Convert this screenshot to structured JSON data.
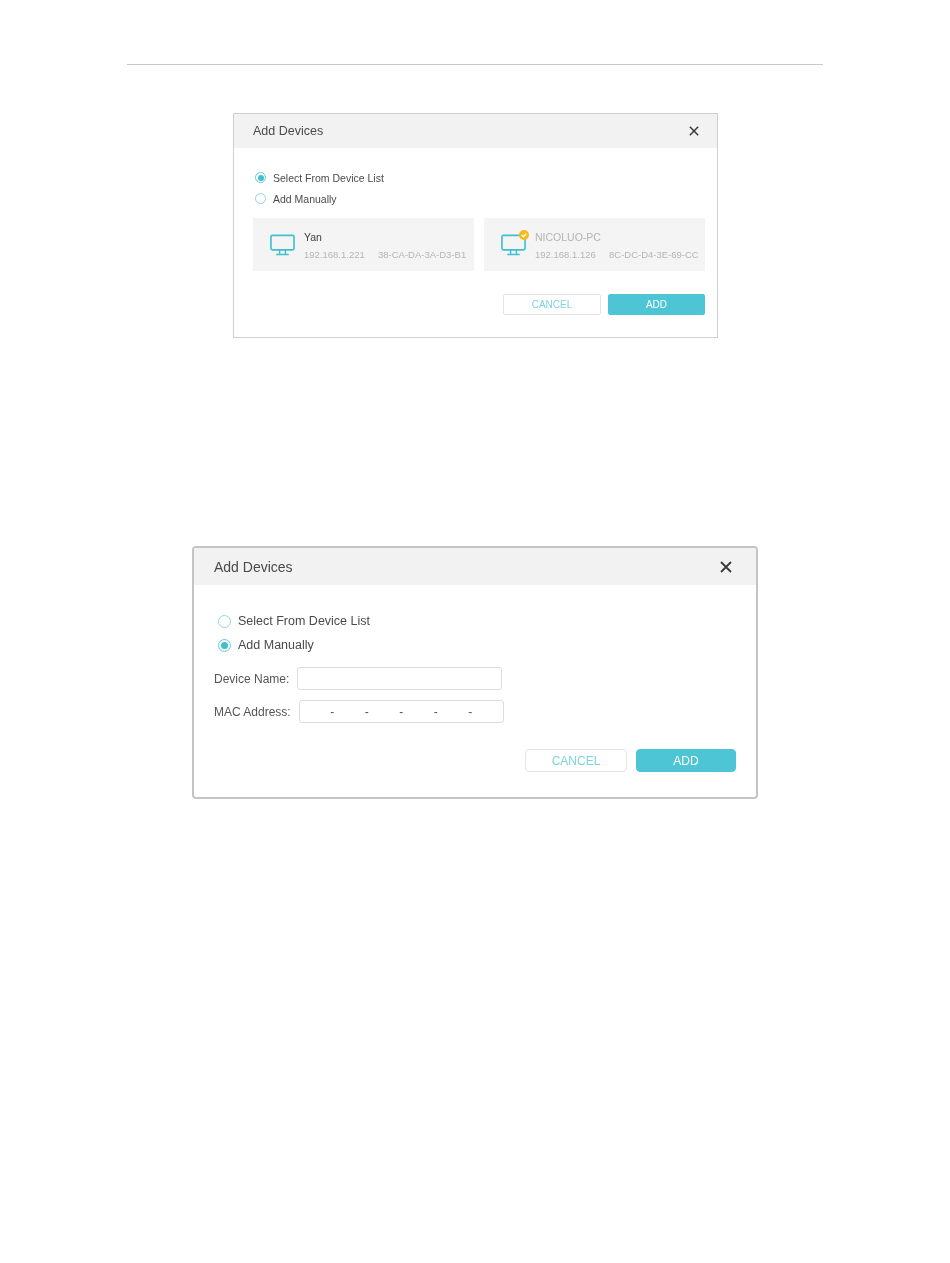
{
  "dialogs": [
    {
      "title": "Add Devices",
      "options": [
        {
          "label": "Select From Device List",
          "selected": true
        },
        {
          "label": "Add Manually",
          "selected": false
        }
      ],
      "devices": [
        {
          "name": "Yan",
          "ip": "192.168.1.221",
          "mac": "38-CA-DA-3A-D3-B1",
          "disabled": false,
          "badge": false
        },
        {
          "name": "NICOLUO-PC",
          "ip": "192.168.1.126",
          "mac": "8C-DC-D4-3E-69-CC",
          "disabled": true,
          "badge": true
        }
      ],
      "buttons": [
        {
          "label": "CANCEL",
          "kind": "secondary"
        },
        {
          "label": "ADD",
          "kind": "primary"
        }
      ]
    },
    {
      "title": "Add Devices",
      "options": [
        {
          "label": "Select From Device List",
          "selected": false
        },
        {
          "label": "Add Manually",
          "selected": true
        }
      ],
      "fields": [
        {
          "label": "Device Name:",
          "kind": "name"
        },
        {
          "label": "MAC Address:",
          "kind": "mac",
          "separators": [
            "-",
            "-",
            "-",
            "-",
            "-"
          ]
        }
      ],
      "buttons": [
        {
          "label": "CANCEL",
          "kind": "secondary"
        },
        {
          "label": "ADD",
          "kind": "primary"
        }
      ]
    }
  ]
}
